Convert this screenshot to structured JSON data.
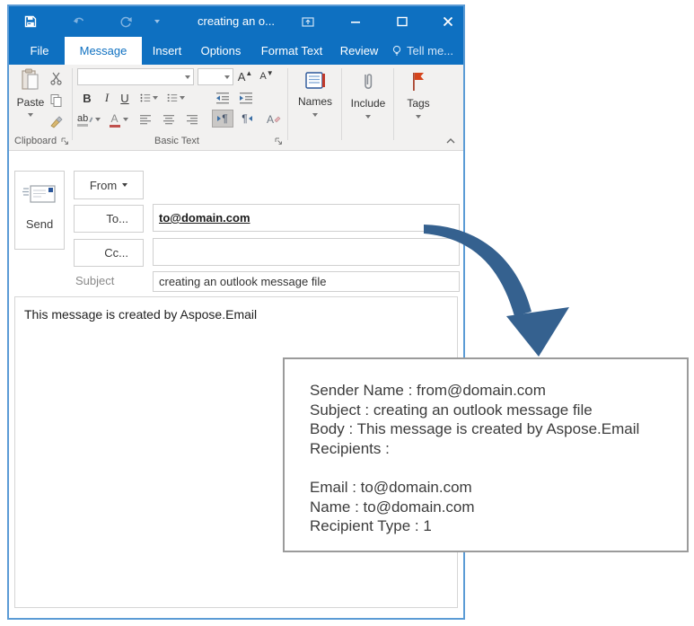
{
  "window": {
    "title": "creating an o...",
    "tabs": [
      "File",
      "Message",
      "Insert",
      "Options",
      "Format Text",
      "Review"
    ],
    "selected_tab": "Message",
    "tell_me_label": "Tell me..."
  },
  "ribbon": {
    "paste_label": "Paste",
    "clipboard_group_label": "Clipboard",
    "basic_text_group_label": "Basic Text",
    "names_label": "Names",
    "include_label": "Include",
    "tags_label": "Tags",
    "glyphs": {
      "bold": "B",
      "italic": "I",
      "underline": "U",
      "grow_font": "A",
      "shrink_font": "A",
      "highlight": "ab",
      "font_color": "A",
      "clear_formatting": "A",
      "pilcrow": "¶"
    }
  },
  "compose": {
    "send_label": "Send",
    "from_label": "From",
    "to_label": "To...",
    "cc_label": "Cc...",
    "subject_label": "Subject",
    "to_value": "to@domain.com",
    "cc_value": "",
    "subject_value": "creating an outlook message file",
    "body_text": "This message is created by Aspose.Email"
  },
  "output_box": {
    "lines": [
      "Sender Name : from@domain.com",
      "Subject : creating an outlook message file",
      "Body : This message is created by Aspose.Email",
      "Recipients :",
      "",
      "Email : to@domain.com",
      "Name : to@domain.com",
      "Recipient Type : 1"
    ]
  },
  "colors": {
    "titlebar_blue": "#0e70c1",
    "selected_tab_text": "#0e70c1",
    "ribbon_bg": "#f2f1f0",
    "window_border": "#5b9bd5",
    "arrow_blue": "#35618f",
    "tags_flag_red": "#d5441c",
    "popup_border_gray": "#9b9b9b"
  }
}
